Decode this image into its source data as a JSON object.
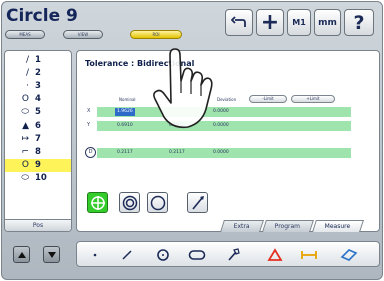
{
  "app": {
    "title": "Circle 9",
    "mode_pills": [
      {
        "label": "MEAS",
        "active": false
      },
      {
        "label": "VIEW",
        "active": false
      },
      {
        "label": "ROI",
        "active": true
      }
    ],
    "toolbar_right": [
      {
        "label": "↶",
        "name": "undo-button"
      },
      {
        "label": "+",
        "name": "add-button"
      },
      {
        "label": "M1",
        "name": "m1-button"
      },
      {
        "label": "mm",
        "name": "units-button"
      },
      {
        "label": "?",
        "name": "help-button"
      }
    ]
  },
  "sidebar": {
    "items": [
      {
        "num": "1",
        "icon": "/",
        "icon_name": "line-icon",
        "selected": false
      },
      {
        "num": "2",
        "icon": "/",
        "icon_name": "line-icon",
        "selected": false
      },
      {
        "num": "3",
        "icon": "·",
        "icon_name": "point-icon",
        "selected": false
      },
      {
        "num": "4",
        "icon": "O",
        "icon_name": "circle-icon",
        "selected": false
      },
      {
        "num": "5",
        "icon": "⬭",
        "icon_name": "slot-icon",
        "selected": false
      },
      {
        "num": "6",
        "icon": "▲",
        "icon_name": "angle-icon",
        "selected": false
      },
      {
        "num": "7",
        "icon": "↦",
        "icon_name": "distance-icon",
        "selected": false
      },
      {
        "num": "8",
        "icon": "⌐",
        "icon_name": "arc-icon",
        "selected": false
      },
      {
        "num": "9",
        "icon": "O",
        "icon_name": "circle-icon",
        "selected": true
      },
      {
        "num": "10",
        "icon": "⬭",
        "icon_name": "slot-icon",
        "selected": false
      }
    ],
    "bottom_tab": "Pos"
  },
  "tolerance": {
    "heading": "Tolerance : Bidirectional",
    "columns": [
      "Nominal",
      "Deviation"
    ],
    "limit_buttons": [
      "-Limit",
      "+Limit"
    ],
    "rows": [
      {
        "label": "X",
        "cells": [
          "1.9626",
          "",
          "0.0000"
        ],
        "highlight_first": true
      },
      {
        "label": "Y",
        "cells": [
          "0.6910",
          "0.6910",
          "0.0000"
        ],
        "highlight_first": false
      },
      {
        "label": "D",
        "cells": [
          "0.2117",
          "0.2117",
          "0.0000"
        ],
        "highlight_first": false
      }
    ]
  },
  "tool_icons": [
    {
      "name": "position-tolerance-icon",
      "active": true
    },
    {
      "name": "concentricity-icon",
      "active": false
    },
    {
      "name": "circularity-icon",
      "active": false
    },
    {
      "name": "runout-icon",
      "active": false
    }
  ],
  "tabs": [
    {
      "label": "Extra",
      "active": false
    },
    {
      "label": "Program",
      "active": false
    },
    {
      "label": "Measure",
      "active": true
    }
  ],
  "bottom_toolbar": [
    {
      "name": "point-tool-icon",
      "glyph": "·"
    },
    {
      "name": "line-tool-icon",
      "glyph": "/"
    },
    {
      "name": "circle-tool-icon",
      "glyph": "O"
    },
    {
      "name": "slot-tool-icon",
      "glyph": "⬭"
    },
    {
      "name": "wrench-tool-icon",
      "glyph": "🔧"
    },
    {
      "name": "angle-tool-icon",
      "glyph": "△"
    },
    {
      "name": "distance-tool-icon",
      "glyph": "↦"
    },
    {
      "name": "eraser-tool-icon",
      "glyph": "◇"
    }
  ],
  "colors": {
    "title": "#15265a",
    "selected_row": "#fff35a",
    "active_pill": "#e2c200",
    "data_row": "#9fe3ad",
    "active_icon": "#33cc2a",
    "highlight_cell": "#2e6bc8"
  }
}
